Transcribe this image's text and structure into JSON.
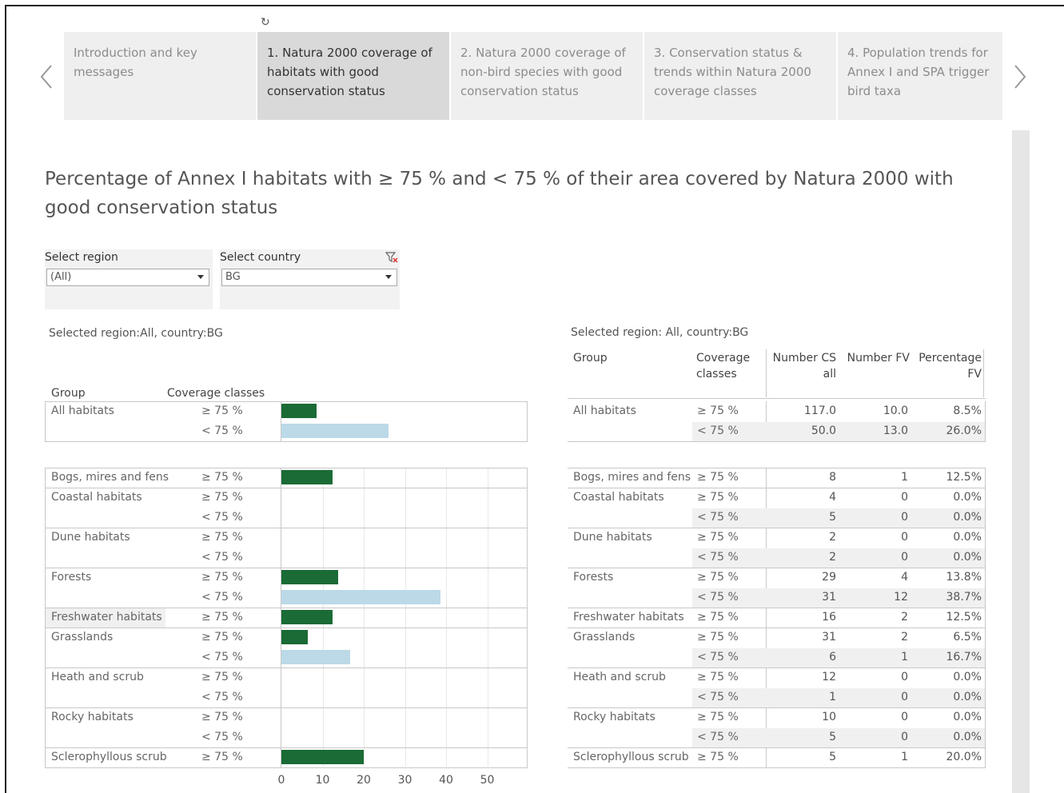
{
  "tabs": [
    {
      "label": "Introduction and key messages",
      "active": false
    },
    {
      "label": "1. Natura 2000 coverage of habitats with good conservation status",
      "active": true
    },
    {
      "label": "2. Natura 2000 coverage of non-bird species with good conservation status",
      "active": false
    },
    {
      "label": "3. Conservation status & trends within Natura 2000 coverage classes",
      "active": false
    },
    {
      "label": "4. Population trends for Annex I and SPA trigger bird taxa",
      "active": false
    }
  ],
  "page_title": "Percentage of Annex I habitats with ≥ 75 % and < 75 % of their area covered by Natura 2000 with good conservation status",
  "filters": {
    "region_label": "Select region",
    "region_value": "(All)",
    "country_label": "Select country",
    "country_value": "BG"
  },
  "left_panel": {
    "selection_text": "Selected region:All, country:BG",
    "col_group": "Group",
    "col_coverage": "Coverage classes"
  },
  "right_panel": {
    "selection_text": "Selected region: All, country:BG",
    "col_group": "Group",
    "col_coverage": "Coverage classes",
    "col_number_cs": "Number CS all",
    "col_number_fv": "Number FV",
    "col_percentage": "Percentage FV"
  },
  "colors": {
    "hi_bar": "#1a6b35",
    "lo_bar": "#bcd9e8"
  },
  "chart_data": {
    "type": "bar",
    "orientation": "horizontal",
    "xlim": [
      0,
      55
    ],
    "x_ticks": [
      "0",
      "10",
      "20",
      "30",
      "40",
      "50"
    ],
    "summary": {
      "group": "All habitats",
      "rows": [
        {
          "cls": "≥ 75 %",
          "cls_table": "≥ 75 %",
          "cs": "117.0",
          "fv": "10.0",
          "pct": "8.5%",
          "value": 8.5
        },
        {
          "cls": "< 75 %",
          "cls_table": "< 75 %",
          "cs": "50.0",
          "fv": "13.0",
          "pct": "26.0%",
          "value": 26.0
        }
      ]
    },
    "groups": [
      {
        "name": "Bogs, mires and fens",
        "rows": [
          {
            "cls": "≥ 75 %",
            "cs": "8",
            "fv": "1",
            "pct": "12.5%",
            "value": 12.5
          }
        ]
      },
      {
        "name": "Coastal habitats",
        "rows": [
          {
            "cls": "≥ 75 %",
            "cs": "4",
            "fv": "0",
            "pct": "0.0%",
            "value": 0
          },
          {
            "cls": "< 75 %",
            "cs": "5",
            "fv": "0",
            "pct": "0.0%",
            "value": 0
          }
        ]
      },
      {
        "name": "Dune habitats",
        "rows": [
          {
            "cls": "≥ 75 %",
            "cs": "2",
            "fv": "0",
            "pct": "0.0%",
            "value": 0
          },
          {
            "cls": "< 75 %",
            "cs": "2",
            "fv": "0",
            "pct": "0.0%",
            "value": 0
          }
        ]
      },
      {
        "name": "Forests",
        "rows": [
          {
            "cls": "≥ 75 %",
            "cs": "29",
            "fv": "4",
            "pct": "13.8%",
            "value": 13.8
          },
          {
            "cls": "< 75 %",
            "cs": "31",
            "fv": "12",
            "pct": "38.7%",
            "value": 38.7
          }
        ]
      },
      {
        "name": "Freshwater habitats",
        "highlight": true,
        "rows": [
          {
            "cls": "≥ 75 %",
            "cs": "16",
            "fv": "2",
            "pct": "12.5%",
            "value": 12.5
          }
        ]
      },
      {
        "name": "Grasslands",
        "rows": [
          {
            "cls": "≥ 75 %",
            "cs": "31",
            "fv": "2",
            "pct": "6.5%",
            "value": 6.5
          },
          {
            "cls": "< 75 %",
            "cs": "6",
            "fv": "1",
            "pct": "16.7%",
            "value": 16.7
          }
        ]
      },
      {
        "name": "Heath and scrub",
        "rows": [
          {
            "cls": "≥ 75 %",
            "cs": "12",
            "fv": "0",
            "pct": "0.0%",
            "value": 0
          },
          {
            "cls": "< 75 %",
            "cs": "1",
            "fv": "0",
            "pct": "0.0%",
            "value": 0
          }
        ]
      },
      {
        "name": "Rocky habitats",
        "rows": [
          {
            "cls": "≥ 75 %",
            "cs": "10",
            "fv": "0",
            "pct": "0.0%",
            "value": 0
          },
          {
            "cls": "< 75 %",
            "cs": "5",
            "fv": "0",
            "pct": "0.0%",
            "value": 0
          }
        ]
      },
      {
        "name": "Sclerophyllous scrub",
        "rows": [
          {
            "cls": "≥ 75 %",
            "cs": "5",
            "fv": "1",
            "pct": "20.0%",
            "value": 20.0
          }
        ]
      }
    ]
  }
}
